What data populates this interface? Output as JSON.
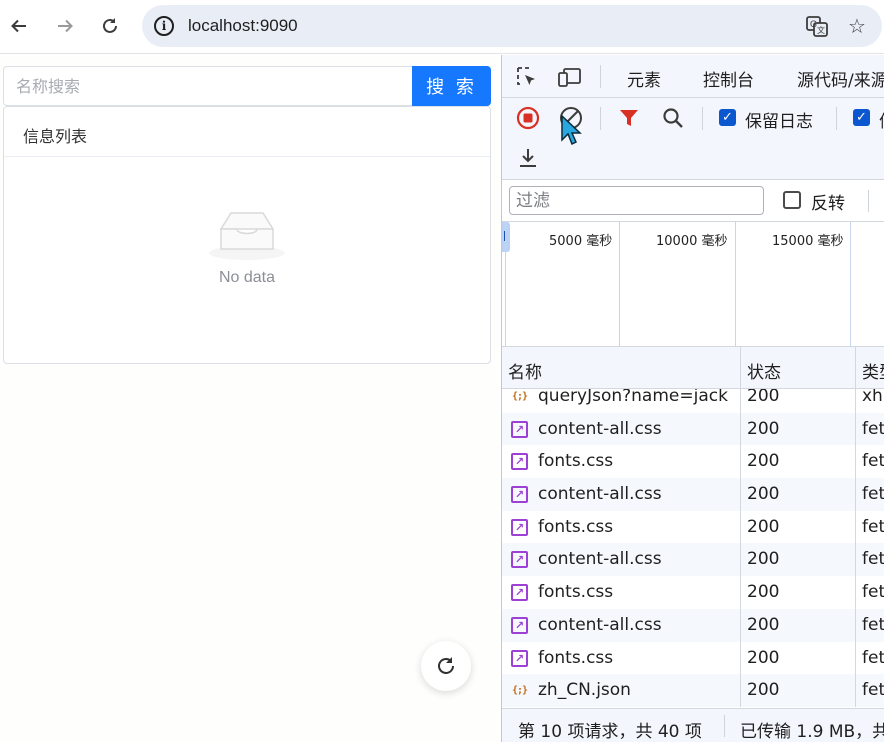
{
  "browser": {
    "url": "localhost:9090"
  },
  "page": {
    "search": {
      "placeholder": "名称搜索",
      "button_label": "搜 索"
    },
    "card": {
      "title": "信息列表",
      "empty_text": "No data"
    }
  },
  "devtools": {
    "tabs": [
      "元素",
      "控制台",
      "源代码/来源"
    ],
    "toolbar": {
      "preserve_log_label": "保留日志",
      "preserve_log_checked": true,
      "second_checkbox_label": "停",
      "second_checked": true
    },
    "filter": {
      "placeholder": "过滤",
      "invert_label": "反转"
    },
    "timeline": {
      "ticks": [
        "5000 毫秒",
        "10000 毫秒",
        "15000 毫秒"
      ]
    },
    "table": {
      "columns": [
        "名称",
        "状态",
        "类型"
      ],
      "rows": [
        {
          "name": "queryJson?name=jack",
          "status": "200",
          "type": "xhr",
          "icon": "json-icon"
        },
        {
          "name": "content-all.css",
          "status": "200",
          "type": "fetch",
          "icon": "css-icon"
        },
        {
          "name": "fonts.css",
          "status": "200",
          "type": "fetch",
          "icon": "css-icon"
        },
        {
          "name": "content-all.css",
          "status": "200",
          "type": "fetch",
          "icon": "css-icon"
        },
        {
          "name": "fonts.css",
          "status": "200",
          "type": "fetch",
          "icon": "css-icon"
        },
        {
          "name": "content-all.css",
          "status": "200",
          "type": "fetch",
          "icon": "css-icon"
        },
        {
          "name": "fonts.css",
          "status": "200",
          "type": "fetch",
          "icon": "css-icon"
        },
        {
          "name": "content-all.css",
          "status": "200",
          "type": "fetch",
          "icon": "css-icon"
        },
        {
          "name": "fonts.css",
          "status": "200",
          "type": "fetch",
          "icon": "css-icon"
        },
        {
          "name": "zh_CN.json",
          "status": "200",
          "type": "fetch",
          "icon": "json-icon"
        }
      ]
    },
    "status_bar": {
      "requests": "第 10 项请求，共 40 项",
      "transferred": "已传输 1.9 MB，共"
    }
  },
  "colors": {
    "primary_button": "#1677ff",
    "record_red": "#d93025",
    "filter_red": "#d93025",
    "checkbox_blue": "#0b57d0",
    "css_icon": "#9c41d4",
    "json_icon": "#c46b16"
  }
}
